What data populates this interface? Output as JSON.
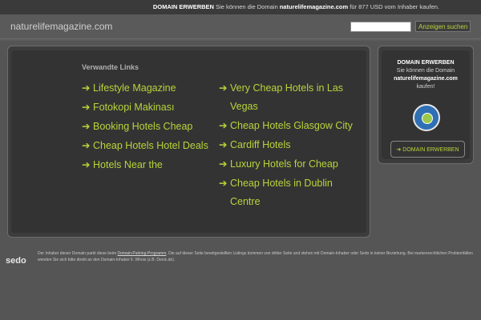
{
  "topbar": {
    "label": "DOMAIN ERWERBEN",
    "text_before": "Sie können die Domain",
    "domain": "naturelifemagazine.com",
    "text_after": "für 877 USD vom Inhaber kaufen."
  },
  "header": {
    "site_name": "naturelifemagazine.com",
    "search": {
      "placeholder": "",
      "value": "",
      "button_label": "Anzeigen suchen"
    }
  },
  "links": {
    "title": "Verwandte Links",
    "arrow": "➔",
    "left": [
      "Lifestyle Magazine",
      "Fotokopi Makinası",
      "Booking Hotels Cheap",
      "Cheap Hotels Hotel Deals",
      "Hotels Near the"
    ],
    "right": [
      "Very Cheap Hotels in Las Vegas",
      "Cheap Hotels Glasgow City",
      "Cardiff Hotels",
      "Luxury Hotels for Cheap",
      "Cheap Hotels in Dublin Centre"
    ]
  },
  "side": {
    "title": "DOMAIN ERWERBEN",
    "line1": "Sie können die Domain",
    "domain": "naturelifemagazine.com",
    "line3": "kaufen!",
    "button_label": "DOMAIN ERWERBEN",
    "seal_icon": "trust-seal-icon"
  },
  "footer": {
    "logo": "sedo",
    "text_1": "Der Inhaber dieser Domain parkt diese beim",
    "link": "Domain-Parking-Programm",
    "text_2": ". Die auf dieser Seite bereitgestellten Listings kommen von dritter Seite und stehen mit Domain-Inhaber oder Sedo in keiner Beziehung. Bei markenrechtlichen Problemfällen wenden Sie sich bitte direkt an den Domain-Inhaber lt. Whois (z.B. Denic.de)."
  },
  "colors": {
    "accent": "#b8d43a",
    "background": "#5c5c5c",
    "panel": "#333333"
  }
}
